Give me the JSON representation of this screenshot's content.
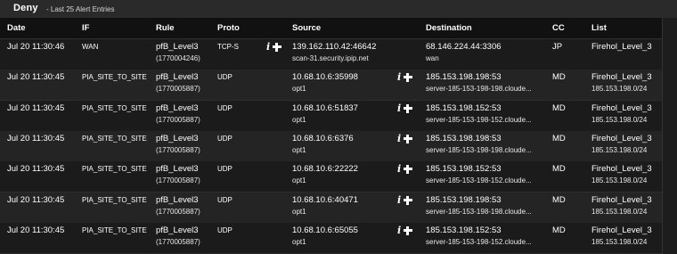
{
  "panel": {
    "title": "Deny",
    "subtitle": "- Last 25 Alert Entries"
  },
  "table": {
    "headers": {
      "date": "Date",
      "if": "IF",
      "rule": "Rule",
      "proto": "Proto",
      "source": "Source",
      "destination": "Destination",
      "cc": "CC",
      "list": "List"
    },
    "rows": [
      {
        "date": "Jul 20 11:30:46",
        "if": "WAN",
        "rule": "pfB_Level3",
        "rule_id": "(1770004246)",
        "proto": "TCP-S",
        "source": "139.162.110.42:46642",
        "source_host": "scan-31.security.ipip.net",
        "destination": "68.146.224.44:3306",
        "destination_host": "wan",
        "cc": "JP",
        "list": "Firehol_Level_3",
        "list_net": "",
        "icon_side": "source"
      },
      {
        "date": "Jul 20 11:30:45",
        "if": "PIA_SITE_TO_SITE",
        "rule": "pfB_Level3",
        "rule_id": "(1770005887)",
        "proto": "UDP",
        "source": "10.68.10.6:35998",
        "source_host": "opt1",
        "destination": "185.153.198.198:53",
        "destination_host": "server-185-153-198-198.cloude...",
        "cc": "MD",
        "list": "Firehol_Level_3",
        "list_net": "185.153.198.0/24",
        "icon_side": "dest"
      },
      {
        "date": "Jul 20 11:30:45",
        "if": "PIA_SITE_TO_SITE",
        "rule": "pfB_Level3",
        "rule_id": "(1770005887)",
        "proto": "UDP",
        "source": "10.68.10.6:51837",
        "source_host": "opt1",
        "destination": "185.153.198.152:53",
        "destination_host": "server-185-153-198-152.cloude...",
        "cc": "MD",
        "list": "Firehol_Level_3",
        "list_net": "185.153.198.0/24",
        "icon_side": "dest"
      },
      {
        "date": "Jul 20 11:30:45",
        "if": "PIA_SITE_TO_SITE",
        "rule": "pfB_Level3",
        "rule_id": "(1770005887)",
        "proto": "UDP",
        "source": "10.68.10.6:6376",
        "source_host": "opt1",
        "destination": "185.153.198.198:53",
        "destination_host": "server-185-153-198-198.cloude...",
        "cc": "MD",
        "list": "Firehol_Level_3",
        "list_net": "185.153.198.0/24",
        "icon_side": "dest"
      },
      {
        "date": "Jul 20 11:30:45",
        "if": "PIA_SITE_TO_SITE",
        "rule": "pfB_Level3",
        "rule_id": "(1770005887)",
        "proto": "UDP",
        "source": "10.68.10.6:22222",
        "source_host": "opt1",
        "destination": "185.153.198.152:53",
        "destination_host": "server-185-153-198-152.cloude...",
        "cc": "MD",
        "list": "Firehol_Level_3",
        "list_net": "185.153.198.0/24",
        "icon_side": "dest"
      },
      {
        "date": "Jul 20 11:30:45",
        "if": "PIA_SITE_TO_SITE",
        "rule": "pfB_Level3",
        "rule_id": "(1770005887)",
        "proto": "UDP",
        "source": "10.68.10.6:40471",
        "source_host": "opt1",
        "destination": "185.153.198.198:53",
        "destination_host": "server-185-153-198-198.cloude...",
        "cc": "MD",
        "list": "Firehol_Level_3",
        "list_net": "185.153.198.0/24",
        "icon_side": "dest"
      },
      {
        "date": "Jul 20 11:30:45",
        "if": "PIA_SITE_TO_SITE",
        "rule": "pfB_Level3",
        "rule_id": "(1770005887)",
        "proto": "UDP",
        "source": "10.68.10.6:65055",
        "source_host": "opt1",
        "destination": "185.153.198.152:53",
        "destination_host": "server-185-153-198-152.cloude...",
        "cc": "MD",
        "list": "Firehol_Level_3",
        "list_net": "185.153.198.0/24",
        "icon_side": "dest"
      }
    ]
  },
  "icons": {
    "info": "info-icon",
    "add": "plus-icon"
  }
}
